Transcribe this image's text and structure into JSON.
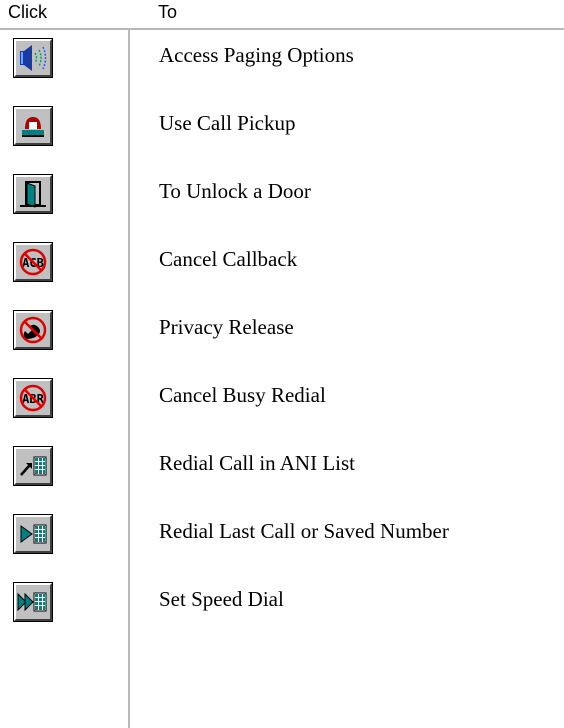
{
  "header": {
    "click": "Click",
    "to": "To"
  },
  "rows": [
    {
      "icon": "paging-speaker-icon",
      "label": "Access Paging Options"
    },
    {
      "icon": "call-pickup-icon",
      "label": "Use Call Pickup"
    },
    {
      "icon": "door-unlock-icon",
      "label": "To Unlock a Door"
    },
    {
      "icon": "cancel-callback-acb-icon",
      "label": "Cancel Callback"
    },
    {
      "icon": "privacy-release-icon",
      "label": "Privacy Release"
    },
    {
      "icon": "cancel-busy-redial-abr-icon",
      "label": "Cancel Busy Redial"
    },
    {
      "icon": "redial-ani-list-icon",
      "label": "Redial Call in ANI List"
    },
    {
      "icon": "redial-last-call-icon",
      "label": "Redial Last Call or Saved Number"
    },
    {
      "icon": "set-speed-dial-icon",
      "label": "Set Speed Dial"
    }
  ]
}
